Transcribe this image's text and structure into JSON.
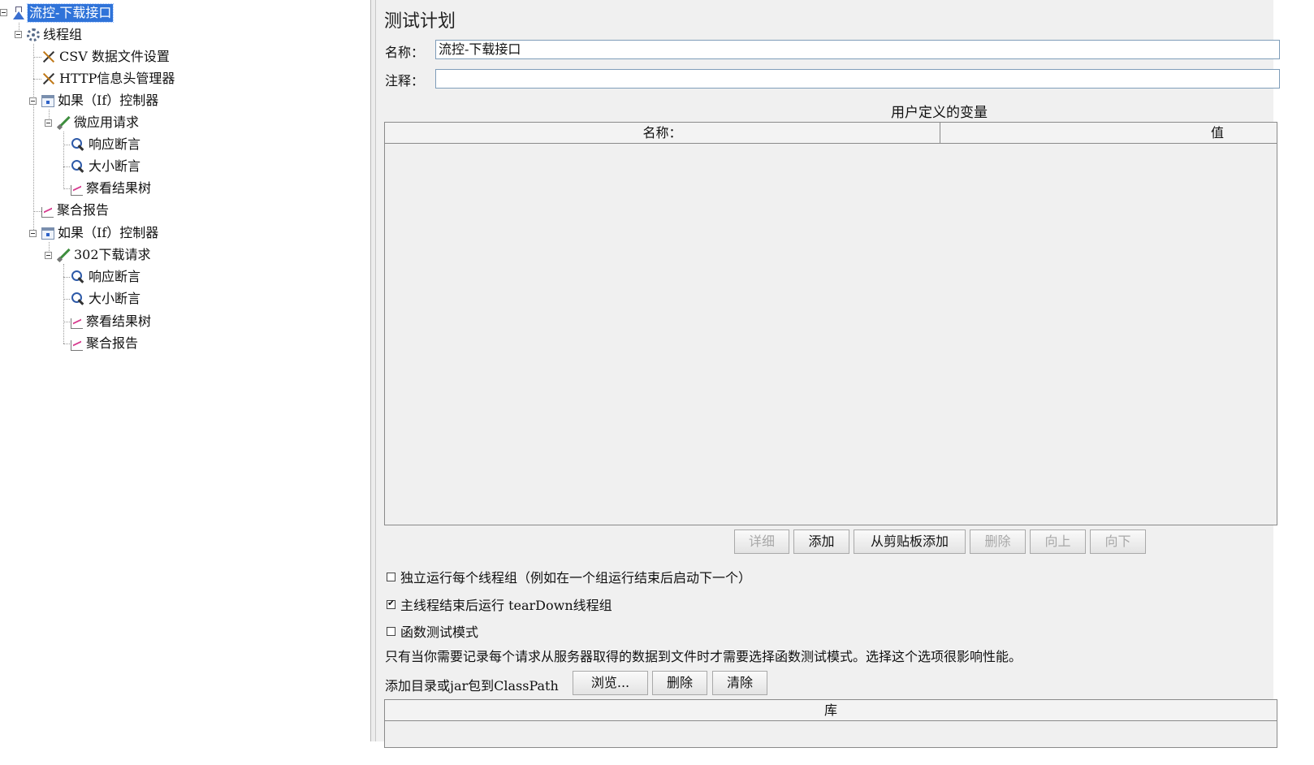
{
  "tree": {
    "items": [
      {
        "label": "流控-下载接口",
        "icon": "flask-icon",
        "selected": true
      },
      {
        "label": "线程组",
        "icon": "gear-icon"
      },
      {
        "label": "CSV 数据文件设置",
        "icon": "tools-icon"
      },
      {
        "label": "HTTP信息头管理器",
        "icon": "tools-icon"
      },
      {
        "label": "如果（If）控制器",
        "icon": "controller-icon"
      },
      {
        "label": "微应用请求",
        "icon": "sampler-pen-icon"
      },
      {
        "label": "响应断言",
        "icon": "magnifier-icon"
      },
      {
        "label": "大小断言",
        "icon": "magnifier-icon"
      },
      {
        "label": "察看结果树",
        "icon": "graph-icon"
      },
      {
        "label": "聚合报告",
        "icon": "graph-icon"
      },
      {
        "label": "如果（If）控制器",
        "icon": "controller-icon"
      },
      {
        "label": "302下载请求",
        "icon": "sampler-pen-icon"
      },
      {
        "label": "响应断言",
        "icon": "magnifier-icon"
      },
      {
        "label": "大小断言",
        "icon": "magnifier-icon"
      },
      {
        "label": "察看结果树",
        "icon": "graph-icon"
      },
      {
        "label": "聚合报告",
        "icon": "graph-icon"
      }
    ]
  },
  "panel": {
    "title": "测试计划",
    "name_label": "名称：",
    "name_value": "流控-下载接口",
    "comment_label": "注释：",
    "comment_value": "",
    "variables_title": "用户定义的变量",
    "columns": {
      "name": "名称：",
      "value": "值"
    },
    "buttons": {
      "detail": "详细",
      "add": "添加",
      "add_clipboard": "从剪贴板添加",
      "delete": "删除",
      "up": "向上",
      "down": "向下"
    },
    "checkboxes": {
      "independent": {
        "label": "独立运行每个线程组（例如在一个组运行结束后启动下一个）",
        "checked": false
      },
      "teardown": {
        "label": "主线程结束后运行 tearDown线程组",
        "checked": true
      },
      "functional": {
        "label": "函数测试模式",
        "checked": false
      }
    },
    "functional_note": "只有当你需要记录每个请求从服务器取得的数据到文件时才需要选择函数测试模式。选择这个选项很影响性能。",
    "classpath_label": "添加目录或jar包到ClassPath",
    "classpath_buttons": {
      "browse": "浏览...",
      "delete": "删除",
      "clear": "清除"
    },
    "library_column": "库"
  },
  "colors": {
    "selection": "#2f73d9",
    "panel_bg": "#f0f0f0"
  }
}
